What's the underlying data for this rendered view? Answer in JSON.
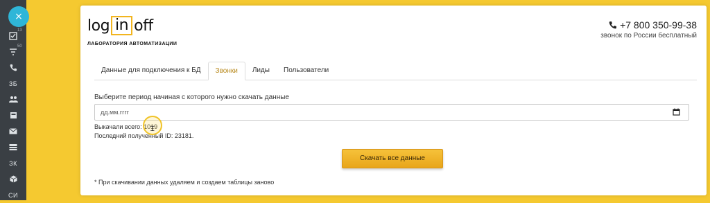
{
  "sidebar": {
    "close_label": "×",
    "items": [
      {
        "icon": "checklist-icon",
        "count": "13"
      },
      {
        "icon": "filter-icon",
        "count": "50"
      },
      {
        "icon": "phone-icon"
      },
      {
        "text": "ЗБ"
      },
      {
        "icon": "users-icon"
      },
      {
        "icon": "card-icon"
      },
      {
        "icon": "mail-icon"
      },
      {
        "icon": "stack-icon"
      },
      {
        "text": "ЗК"
      },
      {
        "icon": "box-icon"
      },
      {
        "text": "СИ"
      }
    ]
  },
  "header": {
    "logo_left": "log",
    "logo_mid": "in",
    "logo_right": "off",
    "logo_sub": "ЛАБОРАТОРИЯ АВТОМАТИЗАЦИИ",
    "phone": "+7 800 350-99-38",
    "phone_note": "звонок по России бесплатный"
  },
  "tabs": [
    {
      "label": "Данные для подключения к БД",
      "active": false
    },
    {
      "label": "Звонки",
      "active": true
    },
    {
      "label": "Лиды",
      "active": false
    },
    {
      "label": "Пользователи",
      "active": false
    }
  ],
  "form": {
    "period_label": "Выберите период начиная с которого нужно скачать данные",
    "date_placeholder": "дд.мм.гггг",
    "downloaded_total": "Выкачали всего: 1019",
    "last_id": "Последний полученный ID: 23181.",
    "download_button": "Скачать все данные",
    "footnote": "* При скачивании данных удаляем и создаем таблицы заново"
  },
  "colors": {
    "background": "#f5c930",
    "sidebar": "#3a3f44",
    "accent": "#f2b51f",
    "close_button": "#2fb6d8"
  }
}
